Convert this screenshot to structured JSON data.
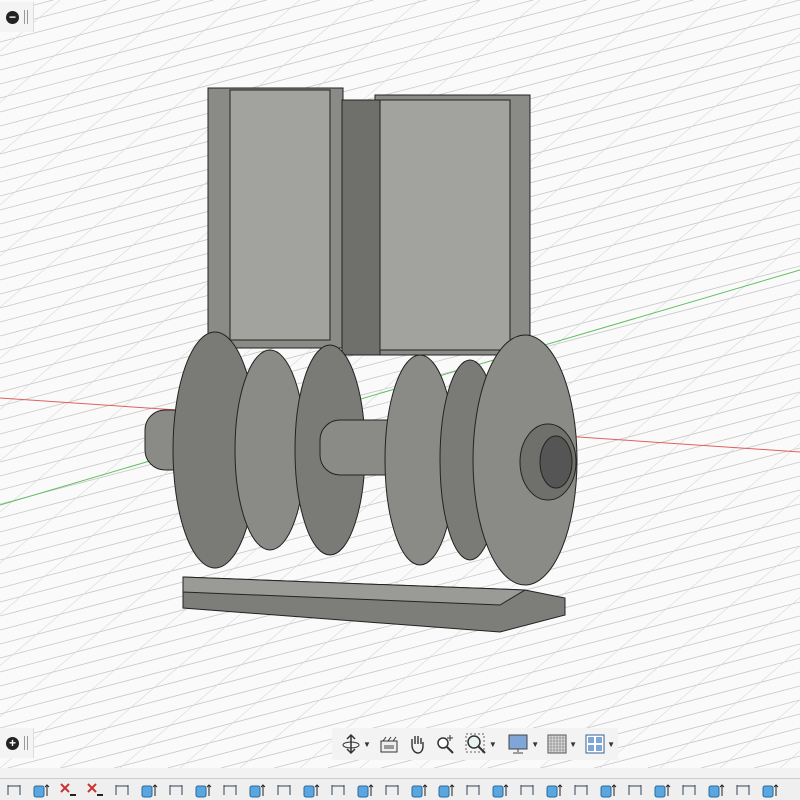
{
  "viewport": {
    "background": "#fafafa",
    "grid_color": "#c8c8c8",
    "x_axis_color": "#e06060",
    "y_axis_color": "#60c060",
    "model_color": "#8a8a86"
  },
  "side_buttons": [
    {
      "icon": "minus-circle-icon",
      "symbol": "−"
    },
    {
      "icon": "plus-circle-icon",
      "symbol": "+"
    }
  ],
  "nav_toolbar": [
    {
      "icon": "orbit-icon",
      "dropdown": true
    },
    {
      "icon": "look-at-icon",
      "dropdown": false
    },
    {
      "icon": "pan-hand-icon",
      "dropdown": false
    },
    {
      "icon": "zoom-icon",
      "dropdown": false
    },
    {
      "icon": "fit-zoom-window-icon",
      "dropdown": true
    },
    {
      "icon": "display-settings-icon",
      "dropdown": true
    },
    {
      "icon": "grid-settings-icon",
      "dropdown": true
    },
    {
      "icon": "viewports-icon",
      "dropdown": true
    }
  ],
  "timeline": [
    "sketch",
    "extrude",
    "delete",
    "delete",
    "sketch",
    "extrude",
    "sketch",
    "extrude",
    "sketch",
    "extrude",
    "sketch",
    "extrude",
    "sketch",
    "extrude",
    "sketch",
    "extrude",
    "extrude",
    "sketch",
    "extrude",
    "sketch",
    "extrude",
    "sketch",
    "extrude",
    "sketch",
    "extrude",
    "sketch",
    "extrude",
    "sketch",
    "extrude"
  ]
}
